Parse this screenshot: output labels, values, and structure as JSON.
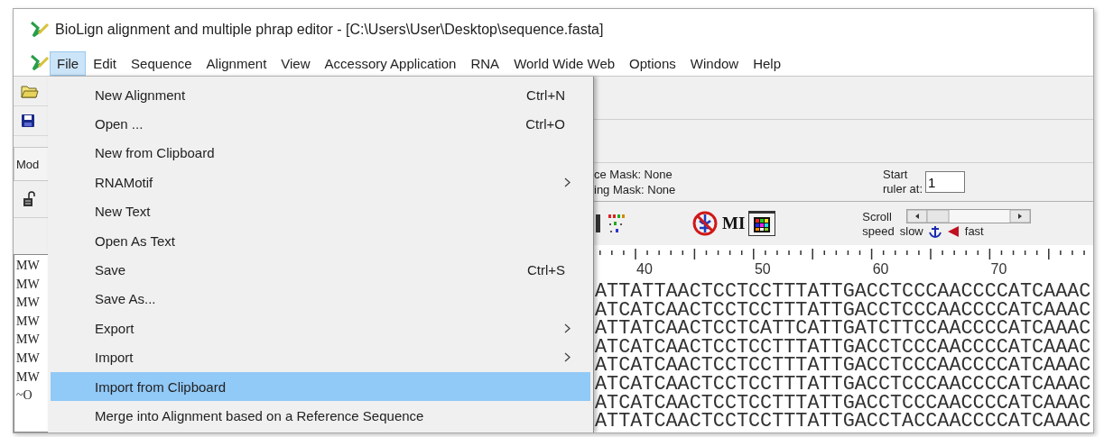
{
  "window": {
    "title": "BioLign alignment and multiple phrap editor - [C:\\Users\\User\\Desktop\\sequence.fasta]"
  },
  "menu_bar": [
    {
      "label": "File",
      "selected": true
    },
    {
      "label": "Edit",
      "selected": false
    },
    {
      "label": "Sequence",
      "selected": false
    },
    {
      "label": "Alignment",
      "selected": false
    },
    {
      "label": "View",
      "selected": false
    },
    {
      "label": "Accessory Application",
      "selected": false
    },
    {
      "label": "RNA",
      "selected": false
    },
    {
      "label": "World Wide Web",
      "selected": false
    },
    {
      "label": "Options",
      "selected": false
    },
    {
      "label": "Window",
      "selected": false
    },
    {
      "label": "Help",
      "selected": false
    }
  ],
  "file_menu": [
    {
      "label": "New Alignment",
      "shortcut": "Ctrl+N",
      "submenu": false,
      "selected": false
    },
    {
      "label": "Open ...",
      "shortcut": "Ctrl+O",
      "submenu": false,
      "selected": false
    },
    {
      "label": "New from Clipboard",
      "submenu": false,
      "selected": false
    },
    {
      "label": "RNAMotif",
      "submenu": true,
      "selected": false
    },
    {
      "label": "New Text",
      "submenu": false,
      "selected": false
    },
    {
      "label": "Open As Text",
      "submenu": false,
      "selected": false
    },
    {
      "label": "Save",
      "shortcut": "Ctrl+S",
      "submenu": false,
      "selected": false
    },
    {
      "label": "Save As...",
      "submenu": false,
      "selected": false
    },
    {
      "label": "Export",
      "submenu": true,
      "selected": false
    },
    {
      "label": "Import",
      "submenu": true,
      "selected": false
    },
    {
      "label": "Import from Clipboard",
      "submenu": false,
      "selected": true
    },
    {
      "label": "Merge into Alignment based on a Reference Sequence",
      "submenu": false,
      "selected": false
    }
  ],
  "left_panel": {
    "mode_label": "Mod",
    "sequence_names": [
      "MW",
      "MW",
      "MW",
      "MW",
      "MW",
      "MW",
      "MW",
      "~O"
    ]
  },
  "mask_panel": {
    "sequence_mask": "ce Mask: None",
    "coloring_mask": "ing Mask: None",
    "start_label": "Start",
    "ruler_label": "ruler at:",
    "ruler_start": "1"
  },
  "toolbar": {
    "mi_label": "MI",
    "scroll_label": "Scroll",
    "speed_label": "speed",
    "slow_label": "slow",
    "fast_label": "fast"
  },
  "ruler": [
    "40",
    "50",
    "60",
    "70"
  ],
  "sequences": [
    "ATTATTAACTCCTCCTTTATTGACCTCCCAACCCCATCAAAC",
    "ATCATCAACTCCTCCTTTATTGACCTCCCAACCCCATCAAAC",
    "ATTATCAACTCCTCATTCATTGATCTTCCAACCCCATCAAAC",
    "ATCATCAACTCCTCCTTTATTGACCTCCCAACCCCATCAAAC",
    "ATCATCAACTCCTCCTTTATTGACCTCCCAACCCCATCAAAC",
    "ATCATCAACTCCTCCTTTATTGACCTCCCAACCCCATCAAAC",
    "ATCATCAACTCCTCCTTTATTGACCTCCCAACCCCATCAAAC",
    "ATTATCAACTCCTCCTTTATTGACCTACCAACCCCATCAAAC"
  ]
}
